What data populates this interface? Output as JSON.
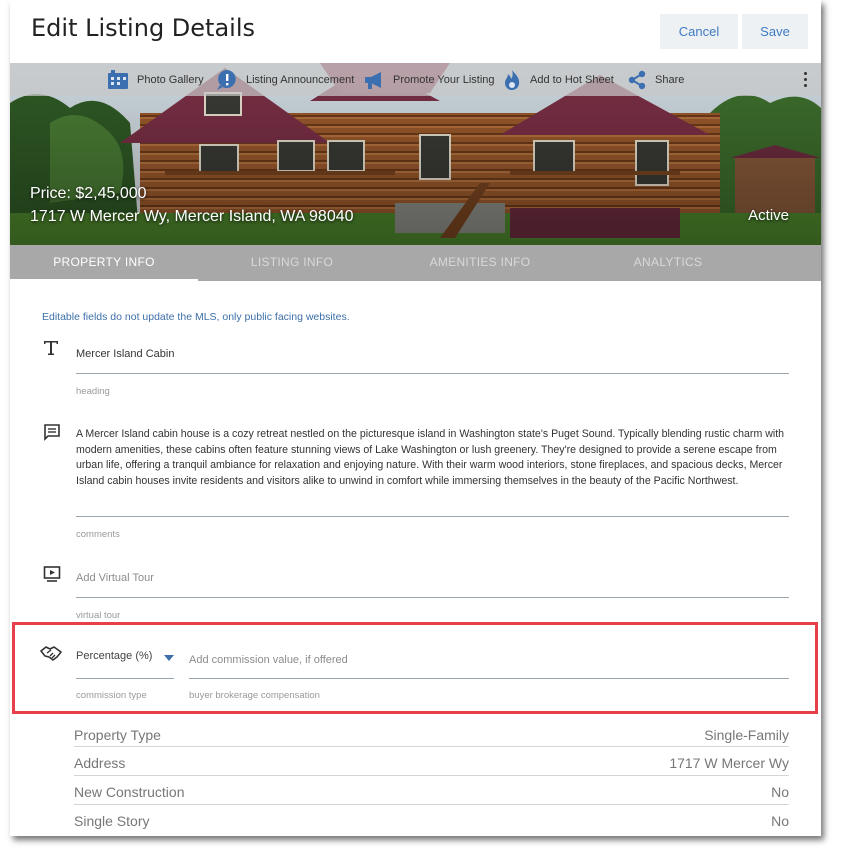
{
  "header": {
    "title": "Edit Listing Details",
    "cancel_label": "Cancel",
    "save_label": "Save"
  },
  "toolbar": {
    "items": [
      {
        "label": "Photo Gallery",
        "icon": "photo-gallery-icon"
      },
      {
        "label": "Listing Announcement",
        "icon": "announcement-icon"
      },
      {
        "label": "Promote Your Listing",
        "icon": "megaphone-icon"
      },
      {
        "label": "Add to Hot Sheet",
        "icon": "flame-icon"
      },
      {
        "label": "Share",
        "icon": "share-icon"
      }
    ],
    "more_icon": "kebab-menu-icon"
  },
  "hero": {
    "price": "Price: $2,45,000",
    "address": "1717 W Mercer Wy, Mercer Island, WA 98040",
    "status": "Active"
  },
  "tabs": [
    {
      "label": "PROPERTY INFO",
      "active": true
    },
    {
      "label": "LISTING INFO",
      "active": false
    },
    {
      "label": "AMENITIES INFO",
      "active": false
    },
    {
      "label": "ANALYTICS",
      "active": false
    }
  ],
  "form": {
    "notice": "Editable fields do not update the MLS, only public facing websites.",
    "heading": {
      "value": "Mercer Island Cabin",
      "label": "heading",
      "icon": "text-icon"
    },
    "comments": {
      "value": "A Mercer Island cabin house is a cozy retreat nestled on the picturesque island in Washington state's Puget Sound. Typically blending rustic charm with modern amenities, these cabins often feature stunning views of Lake Washington or lush greenery. They're designed to provide a serene escape from urban life, offering a tranquil ambiance for relaxation and enjoying nature. With their warm wood interiors, stone fireplaces, and spacious decks, Mercer Island cabin houses invite residents and visitors alike to unwind in comfort while immersing themselves in the beauty of the Pacific Northwest.",
      "label": "comments",
      "icon": "comment-icon"
    },
    "virtual_tour": {
      "placeholder": "Add Virtual Tour",
      "label": "virtual tour",
      "icon": "video-play-icon"
    },
    "commission": {
      "icon": "handshake-icon",
      "type_value": "Percentage (%)",
      "type_label": "commission type",
      "value_placeholder": "Add commission value, if offered",
      "value_label": "buyer brokerage compensation"
    }
  },
  "details": [
    {
      "key": "Property Type",
      "value": "Single-Family"
    },
    {
      "key": "Address",
      "value": "1717 W Mercer Wy"
    },
    {
      "key": "New Construction",
      "value": "No"
    },
    {
      "key": "Single Story",
      "value": "No"
    }
  ],
  "colors": {
    "accent": "#3d7bc4",
    "notice": "#3d6fa8",
    "tabs_bg": "#a8a8a8",
    "highlight": "#e8404a"
  }
}
